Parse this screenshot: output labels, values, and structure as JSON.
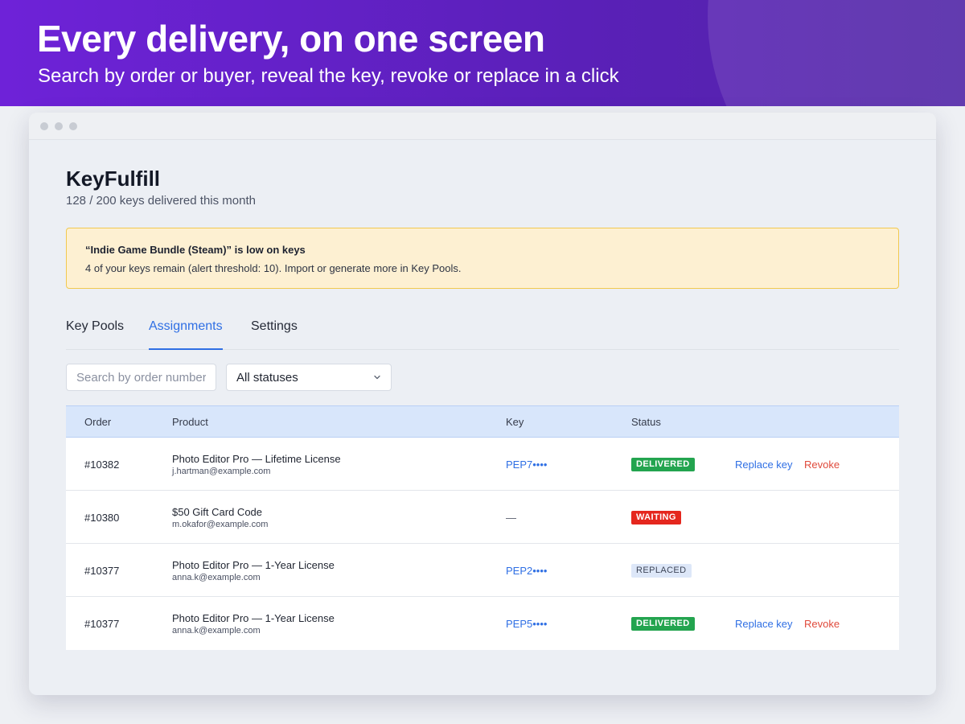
{
  "hero": {
    "title": "Every delivery, on one screen",
    "subtitle": "Search by order or buyer, reveal the key, revoke or replace in a click"
  },
  "app": {
    "title": "KeyFulfill",
    "usage": "128 / 200 keys delivered this month"
  },
  "alert": {
    "title": "“Indie Game Bundle (Steam)” is low on keys",
    "body": "4 of your keys remain (alert threshold: 10). Import or generate more in Key Pools."
  },
  "tabs": [
    {
      "label": "Key Pools"
    },
    {
      "label": "Assignments"
    },
    {
      "label": "Settings"
    }
  ],
  "filters": {
    "search_placeholder": "Search by order number or email",
    "status_value": "All statuses"
  },
  "table": {
    "headers": {
      "order": "Order",
      "product": "Product",
      "key": "Key",
      "status": "Status"
    },
    "rows": [
      {
        "order": "#10382",
        "product": "Photo Editor Pro — Lifetime License",
        "email": "j.hartman@example.com",
        "key": "PEP7••••",
        "status": "DELIVERED",
        "replace": "Replace key",
        "revoke": "Revoke"
      },
      {
        "order": "#10380",
        "product": "$50 Gift Card Code",
        "email": "m.okafor@example.com",
        "key": "—",
        "status": "WAITING"
      },
      {
        "order": "#10377",
        "product": "Photo Editor Pro — 1-Year License",
        "email": "anna.k@example.com",
        "key": "PEP2••••",
        "status": "REPLACED"
      },
      {
        "order": "#10377",
        "product": "Photo Editor Pro — 1-Year License",
        "email": "anna.k@example.com",
        "key": "PEP5••••",
        "status": "DELIVERED",
        "replace": "Replace key",
        "revoke": "Revoke"
      }
    ]
  },
  "colors": {
    "accent": "#2f6fe4",
    "delivered": "#23a44f",
    "waiting": "#e5271e",
    "revoke": "#e04a3b",
    "alert_bg": "#fdf0d2"
  }
}
